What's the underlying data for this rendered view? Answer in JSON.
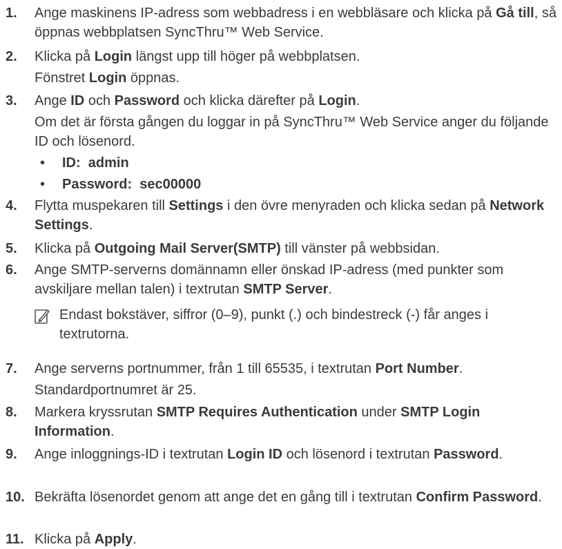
{
  "steps": [
    {
      "num": "1.",
      "parts": [
        "Ange maskinens IP-adress som webbadress i en webbläsare och klicka på ",
        "Gå till",
        ", så öppnas webbplatsen SyncThru™ Web Service."
      ]
    },
    {
      "num": "2.",
      "parts": [
        "Klicka på ",
        "Login",
        " längst upp till höger på webbplatsen."
      ]
    },
    {
      "num": "3.",
      "parts": [
        "Ange ",
        "ID",
        " och ",
        "Password",
        " och klicka därefter på ",
        "Login",
        "."
      ]
    },
    {
      "num": "4.",
      "parts": [
        "Flytta muspekaren till ",
        "Settings",
        " i den övre menyraden och klicka sedan på ",
        "Network Settings",
        "."
      ]
    },
    {
      "num": "5.",
      "parts": [
        "Klicka på ",
        "Outgoing Mail Server(SMTP)",
        " till vänster på webbsidan."
      ]
    },
    {
      "num": "6.",
      "parts": [
        "Ange SMTP-serverns domännamn eller önskad IP-adress (med punkter som avskiljare mellan talen) i textrutan ",
        "SMTP Server",
        "."
      ]
    },
    {
      "num": "7.",
      "parts": [
        "Ange serverns portnummer, från 1 till 65535, i textrutan ",
        "Port Number",
        "."
      ]
    },
    {
      "num": "8.",
      "parts": [
        "Markera kryssrutan ",
        "SMTP Requires Authentication",
        " under ",
        "SMTP Login Information",
        "."
      ]
    },
    {
      "num": "9.",
      "parts": [
        "Ange inloggnings-ID i textrutan ",
        "Login ID",
        " och lösenord i textrutan ",
        "Password",
        "."
      ]
    },
    {
      "num": "10.",
      "parts": [
        "Bekräfta lösenordet genom att ange det en gång till i textrutan ",
        "Confirm Password",
        "."
      ]
    },
    {
      "num": "11.",
      "parts": [
        "Klicka på ",
        "Apply",
        "."
      ]
    }
  ],
  "step2_sub": {
    "bold": "Login",
    "rest": " öppnas.",
    "prefix": "Fönstret "
  },
  "step3_sub": "Om det är första gången du loggar in på SyncThru™ Web Service anger du följande ID och lösenord.",
  "bullets": [
    {
      "dot": "•",
      "text": "ID:  admin"
    },
    {
      "dot": "•",
      "text": "Password:  sec00000"
    }
  ],
  "note": {
    "icon": "note-pencil-icon",
    "text": "Endast bokstäver, siffror (0–9), punkt (.) och bindestreck (-) får anges i textrutorna."
  },
  "step7_sub": "Standardportnumret är 25."
}
